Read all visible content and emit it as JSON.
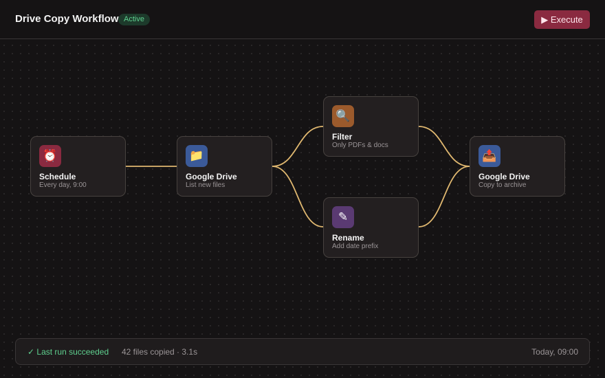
{
  "header": {
    "title": "Drive Copy Workflow",
    "status_badge": "Active",
    "execute_label": "▶ Execute"
  },
  "colors": {
    "accent": "#8a2a40",
    "edge": "#e0b870",
    "success": "#5fd08f"
  },
  "nodes": [
    {
      "id": "schedule",
      "label": "Schedule",
      "subtitle": "Every day, 9:00",
      "icon": "alarm-clock-icon",
      "glyph": "⏰",
      "color": "#8a2a40"
    },
    {
      "id": "drive-source",
      "label": "Google Drive",
      "subtitle": "List new files",
      "icon": "folder-icon",
      "glyph": "📁",
      "color": "#3b5a99"
    },
    {
      "id": "filter",
      "label": "Filter",
      "subtitle": "Only PDFs & docs",
      "icon": "magnifier-icon",
      "glyph": "🔍",
      "color": "#9b5a2c"
    },
    {
      "id": "rename",
      "label": "Rename",
      "subtitle": "Add date prefix",
      "icon": "pencil-icon",
      "glyph": "✎",
      "color": "#5a3a72"
    },
    {
      "id": "drive-target",
      "label": "Google Drive",
      "subtitle": "Copy to archive",
      "icon": "outbox-tray-icon",
      "glyph": "📤",
      "color": "#3b5a99"
    }
  ],
  "status_bar": {
    "result": "✓ Last run succeeded",
    "summary": "42 files copied · 3.1s",
    "timestamp": "Today, 09:00"
  }
}
